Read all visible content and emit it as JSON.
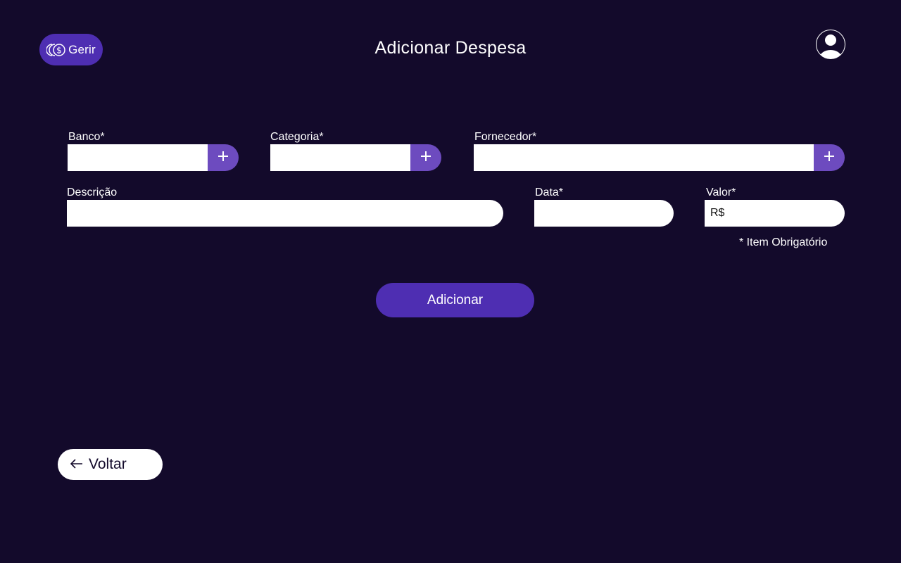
{
  "header": {
    "logo_text": "Gerir",
    "title": "Adicionar Despesa",
    "avatar_icon": "user-avatar-icon"
  },
  "form": {
    "banco": {
      "label": "Banco*",
      "value": ""
    },
    "categoria": {
      "label": "Categoria*",
      "value": ""
    },
    "fornecedor": {
      "label": "Fornecedor*",
      "value": ""
    },
    "descricao": {
      "label": "Descrição",
      "value": ""
    },
    "data": {
      "label": "Data*",
      "value": ""
    },
    "valor": {
      "label": "Valor*",
      "value": "R$"
    },
    "add_icon": "plus-icon",
    "required_note": "* Item Obrigatório",
    "submit_label": "Adicionar"
  },
  "footer": {
    "back_label": "Voltar",
    "back_icon": "arrow-left-icon"
  },
  "colors": {
    "background": "#130a2b",
    "accent": "#4e2eb2",
    "add_button": "#6d4bbf"
  }
}
